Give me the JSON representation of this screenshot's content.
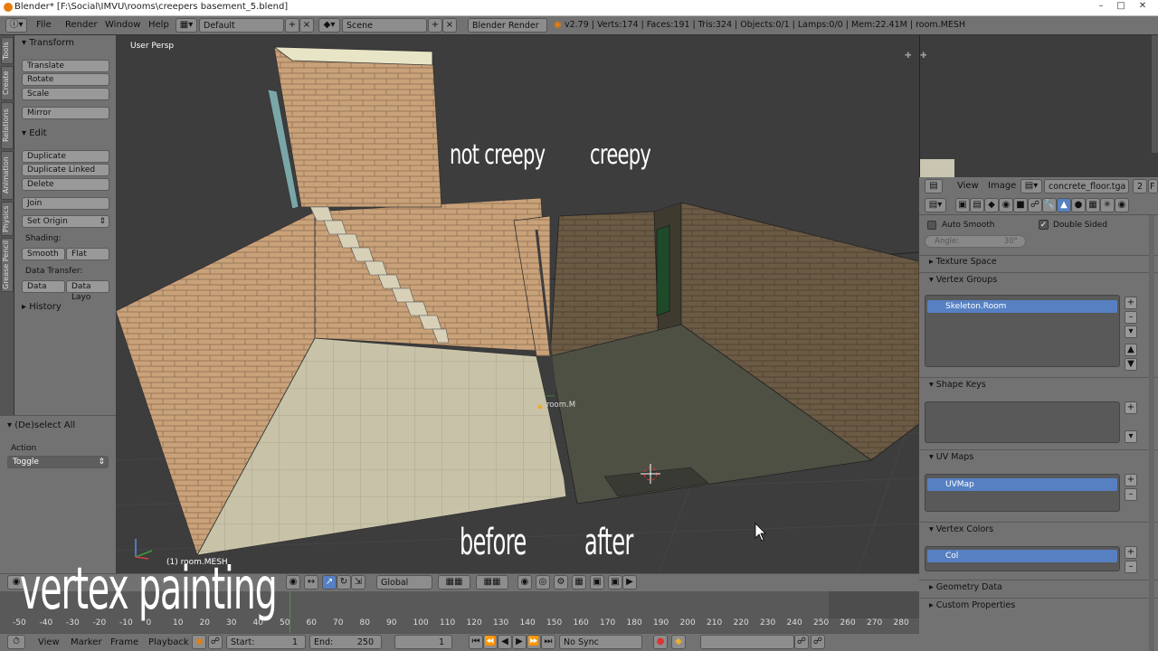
{
  "window": {
    "title": "Blender* [F:\\Social\\IMVU\\rooms\\creepers basement_5.blend]"
  },
  "menu": {
    "file": "File",
    "render": "Render",
    "window": "Window",
    "help": "Help"
  },
  "layout_field": "Default",
  "scene_field": "Scene",
  "engine_field": "Blender Render",
  "stats": "v2.79 | Verts:174 | Faces:191 | Tris:324 | Objects:0/1 | Lamps:0/0 | Mem:22.41M | room.MESH",
  "side_tabs": [
    "Tools",
    "Create",
    "Relations",
    "Animation",
    "Physics",
    "Grease Pencil"
  ],
  "toolshelf": {
    "transform_header": "Transform",
    "translate": "Translate",
    "rotate": "Rotate",
    "scale": "Scale",
    "mirror": "Mirror",
    "edit_header": "Edit",
    "duplicate": "Duplicate",
    "duplicate_linked": "Duplicate Linked",
    "delete": "Delete",
    "join": "Join",
    "set_origin": "Set Origin",
    "shading_label": "Shading:",
    "smooth": "Smooth",
    "flat": "Flat",
    "data_transfer_label": "Data Transfer:",
    "data": "Data",
    "data_layout": "Data Layo",
    "history_header": "History"
  },
  "operator": {
    "header": "(De)select All",
    "action_label": "Action",
    "action_value": "Toggle"
  },
  "viewport": {
    "view_name": "User Persp",
    "object_label": "(1) room.MESH",
    "origin_label": "room.M",
    "annotations": {
      "not_creepy": "not creepy",
      "creepy": "creepy",
      "before": "before",
      "after": "after",
      "vertex_painting": "vertex painting"
    }
  },
  "vp_header": {
    "orientation": "Global"
  },
  "timeline": {
    "ticks": [
      "-50",
      "-40",
      "-30",
      "-20",
      "-10",
      "0",
      "10",
      "20",
      "30",
      "40",
      "50",
      "60",
      "70",
      "80",
      "90",
      "100",
      "110",
      "120",
      "130",
      "140",
      "150",
      "160",
      "170",
      "180",
      "190",
      "200",
      "210",
      "220",
      "230",
      "240",
      "250",
      "260",
      "270",
      "280"
    ],
    "menu_view": "View",
    "menu_marker": "Marker",
    "menu_frame": "Frame",
    "menu_playback": "Playback",
    "start_label": "Start:",
    "start_value": "1",
    "end_label": "End:",
    "end_value": "250",
    "current_frame": "1",
    "sync": "No Sync"
  },
  "image_editor": {
    "menu_view": "View",
    "menu_image": "Image",
    "image_name": "concrete_floor.tga",
    "users": "2",
    "fake": "F"
  },
  "properties": {
    "auto_smooth": "Auto Smooth",
    "double_sided": "Double Sided",
    "angle_label": "Angle:",
    "angle_value": "30°",
    "texture_space": "Texture Space",
    "vertex_groups": "Vertex Groups",
    "vertex_group_item": "Skeleton.Room",
    "shape_keys": "Shape Keys",
    "uv_maps": "UV Maps",
    "uv_map_item": "UVMap",
    "vertex_colors": "Vertex Colors",
    "vertex_color_item": "Col",
    "geometry_data": "Geometry Data",
    "custom_properties": "Custom Properties"
  },
  "colors": {
    "accent": "#5680c2",
    "panel": "#727272",
    "viewport": "#3d3d3d",
    "brick": "#c9a27a",
    "floor": "#c8c3a8"
  }
}
